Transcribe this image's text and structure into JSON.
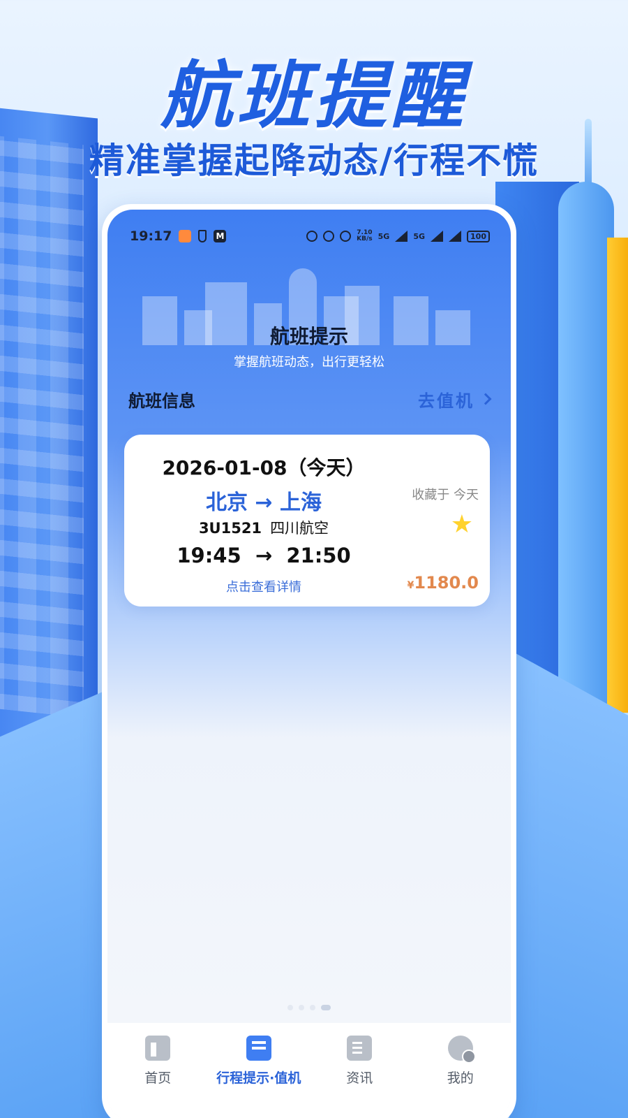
{
  "hero": {
    "title": "航班提醒",
    "subtitle": "精准掌握起降动态/行程不慌"
  },
  "status_bar": {
    "time": "19:17",
    "speed": "7.10",
    "speed_unit": "KB/s",
    "net1": "5G",
    "net2": "5G",
    "battery": "100"
  },
  "header": {
    "title": "航班提示",
    "subtitle": "掌握航班动态，出行更轻松"
  },
  "section": {
    "title": "航班信息",
    "checkin_label": "去值机"
  },
  "flight": {
    "date": "2026-01-08（今天）",
    "route": "北京 → 上海",
    "favorite_label": "收藏于 今天",
    "number": "3U1521",
    "airline": "四川航空",
    "times": "19:45  →  21:50",
    "detail_link": "点击查看详情",
    "price_symbol": "¥",
    "price": "1180.0"
  },
  "tabs": [
    {
      "label": "首页",
      "icon": "home-icon"
    },
    {
      "label": "行程提示·值机",
      "icon": "trip-icon"
    },
    {
      "label": "资讯",
      "icon": "news-icon"
    },
    {
      "label": "我的",
      "icon": "profile-icon"
    }
  ],
  "colors": {
    "accent": "#2b63d8",
    "price": "#e2884d",
    "star": "#ffd22e"
  }
}
